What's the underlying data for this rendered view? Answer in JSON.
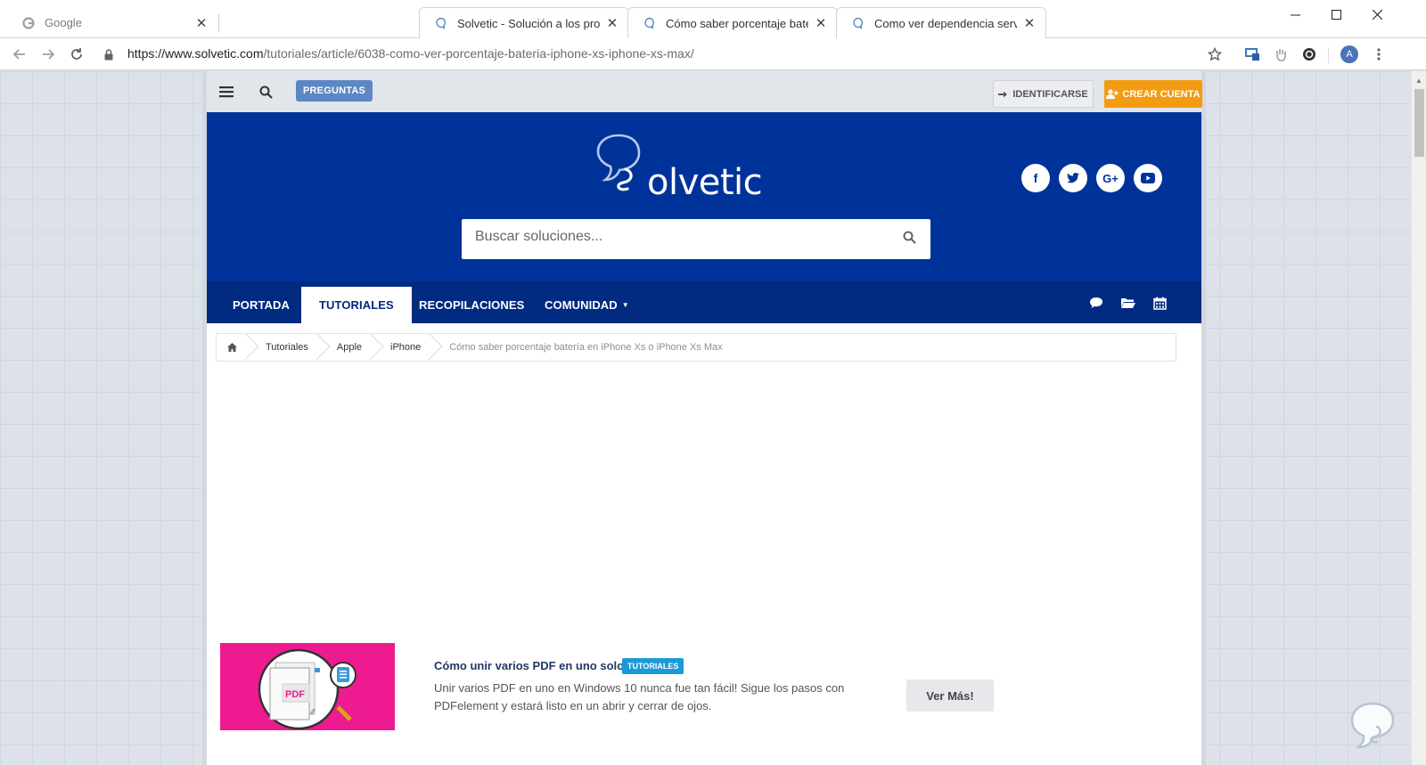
{
  "browser": {
    "tabs": [
      {
        "title": "Google",
        "state": "inactive",
        "icon": "google-favicon"
      },
      {
        "title": "Solvetic - Solución a los problem",
        "state": "active",
        "icon": "solvetic-favicon"
      },
      {
        "title": "Cómo saber porcentaje batería e",
        "state": "active",
        "icon": "solvetic-favicon"
      },
      {
        "title": "Como ver dependencia servicios",
        "state": "active",
        "icon": "solvetic-favicon"
      }
    ],
    "url_host": "https://www.solvetic.com",
    "url_path": "/tutoriales/article/6038-como-ver-porcentaje-bateria-iphone-xs-iphone-xs-max/",
    "profile_initial": "A"
  },
  "site": {
    "topbar": {
      "preguntas_label": "PREGUNTAS",
      "identificarse_label": "IDENTIFICARSE",
      "crear_cuenta_label": "CREAR CUENTA"
    },
    "logo_text": "olvetic",
    "search_placeholder": "Buscar soluciones...",
    "nav": [
      "PORTADA",
      "TUTORIALES",
      "RECOPILACIONES",
      "COMUNIDAD"
    ],
    "active_nav": "TUTORIALES",
    "breadcrumb": [
      "Tutoriales",
      "Apple",
      "iPhone",
      "Cómo saber porcentaje batería en iPhone Xs o iPhone Xs Max"
    ],
    "promo": {
      "title": "Cómo unir varios PDF en uno solo",
      "badge": "TUTORIALES",
      "description": "Unir varios PDF en uno en Windows 10 nunca fue tan fácil! Sigue los pasos con PDFelement y estará listo en un abrir y cerrar de ojos.",
      "button": "Ver Más!",
      "image_label": "PDF"
    }
  },
  "colors": {
    "hero": "#003399",
    "nav": "#002b80",
    "accent_orange": "#f39c12",
    "badge_blue": "#1a9ad9",
    "promo_pink": "#ed1b8f"
  }
}
